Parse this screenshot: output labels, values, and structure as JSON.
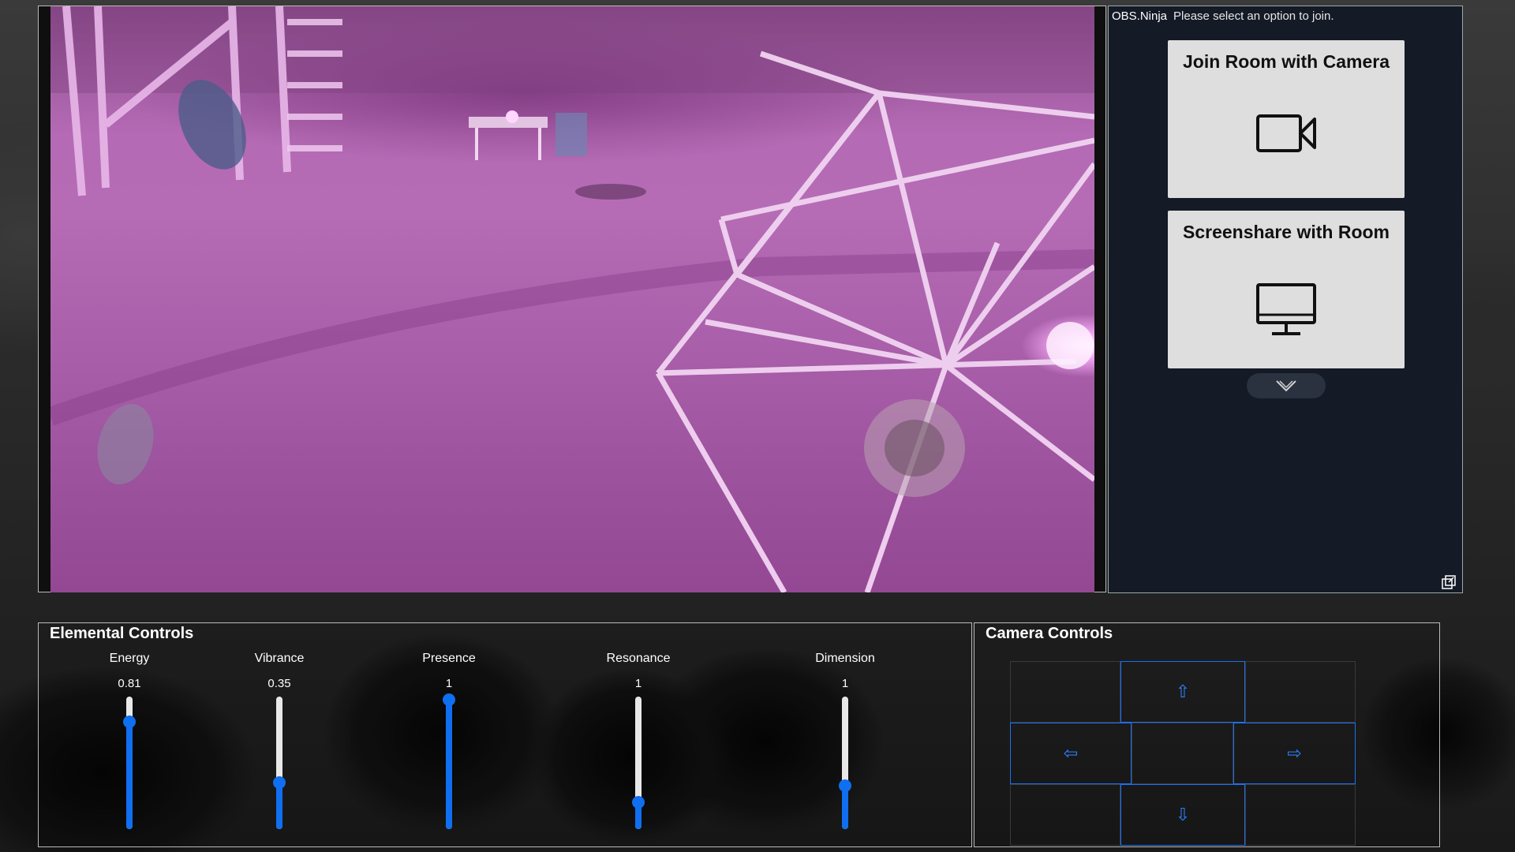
{
  "join_panel": {
    "brand": "OBS.Ninja",
    "prompt": "Please select an option to join.",
    "options": [
      {
        "label": "Join Room with Camera",
        "icon": "video-camera-icon"
      },
      {
        "label": "Screenshare with Room",
        "icon": "desktop-monitor-icon"
      }
    ],
    "more_icon": "chevron-down-icon",
    "popout_icon": "popout-window-icon"
  },
  "elemental_controls": {
    "title": "Elemental Controls",
    "sliders": [
      {
        "label": "Energy",
        "value": "0.81",
        "level": 0.81
      },
      {
        "label": "Vibrance",
        "value": "0.35",
        "level": 0.35
      },
      {
        "label": "Presence",
        "value": "1",
        "level": 1.0
      },
      {
        "label": "Resonance",
        "value": "1",
        "level": 0.2
      },
      {
        "label": "Dimension",
        "value": "1",
        "level": 0.33
      }
    ],
    "accent_color": "#0f6ff0"
  },
  "camera_controls": {
    "title": "Camera Controls",
    "up": "⇧",
    "left": "⇦",
    "right": "⇨",
    "down": "⇩"
  }
}
